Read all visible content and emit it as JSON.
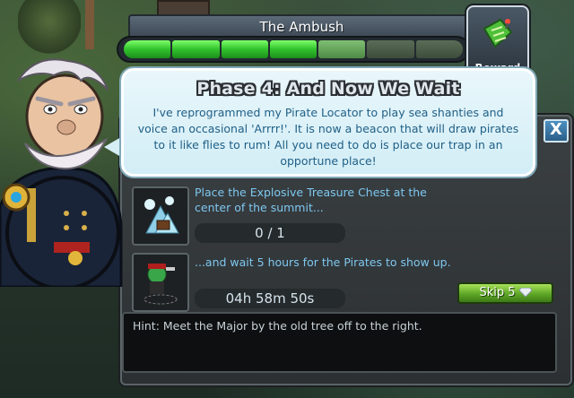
{
  "quest": {
    "title": "The Ambush",
    "progress": {
      "total_segments": 7,
      "filled_segments": 4
    }
  },
  "reward": {
    "label": "Reward",
    "icon": "circuit-board-icon"
  },
  "bubble": {
    "title": "Phase 4: And Now We Wait",
    "text": "I've reprogrammed my Pirate Locator to play sea shanties and voice an occasional 'Arrrr!'. It is now a beacon that will draw pirates to it like flies to rum! All you need to do is place our trap in an opportune place!"
  },
  "tasks": [
    {
      "text": "Place the Explosive Treasure Chest at the center of the summit...",
      "counter": "0 / 1",
      "icon": "treasure-chest-icon"
    },
    {
      "text": "...and wait 5 hours for the Pirates to show up.",
      "counter": "04h 58m 50s",
      "icon": "pirate-icon"
    }
  ],
  "skip": {
    "label": "Skip 5",
    "icon": "gem-icon"
  },
  "hint": {
    "text": "Hint: Meet the Major by the old tree off to the right."
  },
  "close": {
    "label": "X"
  },
  "colors": {
    "progress_green": "#31c22c",
    "task_text": "#7ec8f0",
    "bubble_text": "#1f5f86"
  }
}
